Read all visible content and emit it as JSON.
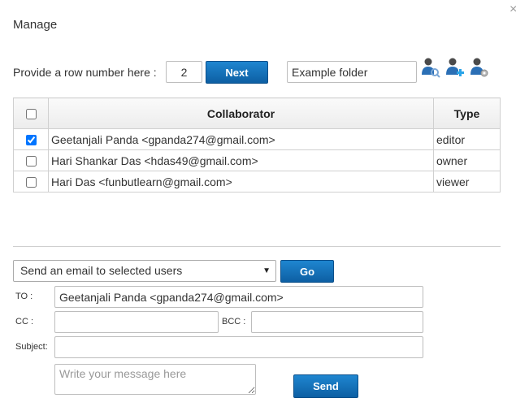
{
  "dialog": {
    "title": "Manage",
    "close_glyph": "×"
  },
  "row_control": {
    "label": "Provide a row number here :",
    "row_value": "2",
    "next_label": "Next",
    "folder_value": "Example folder"
  },
  "icons": [
    "search-user-icon",
    "add-user-icon",
    "user-settings-icon"
  ],
  "table": {
    "headers": {
      "collaborator": "Collaborator",
      "type": "Type"
    },
    "rows": [
      {
        "collaborator": "Geetanjali Panda <gpanda274@gmail.com>",
        "type": "editor",
        "checked": true
      },
      {
        "collaborator": "Hari Shankar Das <hdas49@gmail.com>",
        "type": "owner",
        "checked": false
      },
      {
        "collaborator": "Hari Das <funbutlearn@gmail.com>",
        "type": "viewer",
        "checked": false
      }
    ]
  },
  "email": {
    "action_selected": "Send an email to selected users",
    "go_label": "Go",
    "to_label": "TO :",
    "to_value": "Geetanjali Panda <gpanda274@gmail.com>",
    "cc_label": "CC :",
    "cc_value": "",
    "bcc_label": "BCC :",
    "bcc_value": "",
    "subject_label": "Subject:",
    "subject_value": "",
    "message_placeholder": "Write your message here",
    "send_label": "Send"
  },
  "colors": {
    "button_blue": "#1a75bf",
    "border": "#d0d0d0"
  }
}
